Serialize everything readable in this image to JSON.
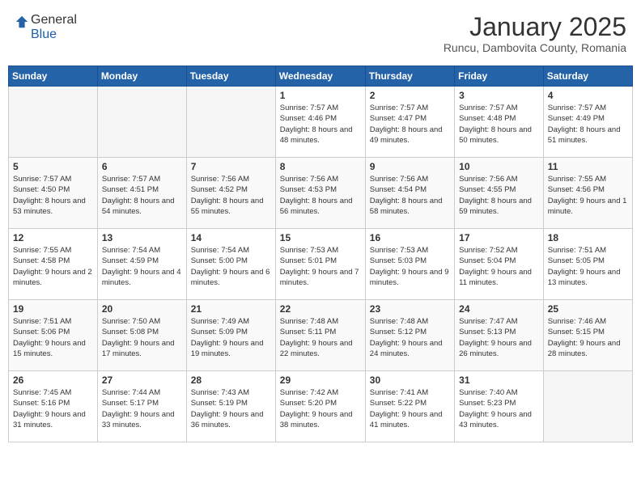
{
  "header": {
    "logo_line1": "General",
    "logo_line2": "Blue",
    "month_title": "January 2025",
    "location": "Runcu, Dambovita County, Romania"
  },
  "weekdays": [
    "Sunday",
    "Monday",
    "Tuesday",
    "Wednesday",
    "Thursday",
    "Friday",
    "Saturday"
  ],
  "weeks": [
    [
      {
        "day": "",
        "sunrise": "",
        "sunset": "",
        "daylight": "",
        "empty": true
      },
      {
        "day": "",
        "sunrise": "",
        "sunset": "",
        "daylight": "",
        "empty": true
      },
      {
        "day": "",
        "sunrise": "",
        "sunset": "",
        "daylight": "",
        "empty": true
      },
      {
        "day": "1",
        "sunrise": "7:57 AM",
        "sunset": "4:46 PM",
        "daylight": "8 hours and 48 minutes."
      },
      {
        "day": "2",
        "sunrise": "7:57 AM",
        "sunset": "4:47 PM",
        "daylight": "8 hours and 49 minutes."
      },
      {
        "day": "3",
        "sunrise": "7:57 AM",
        "sunset": "4:48 PM",
        "daylight": "8 hours and 50 minutes."
      },
      {
        "day": "4",
        "sunrise": "7:57 AM",
        "sunset": "4:49 PM",
        "daylight": "8 hours and 51 minutes."
      }
    ],
    [
      {
        "day": "5",
        "sunrise": "7:57 AM",
        "sunset": "4:50 PM",
        "daylight": "8 hours and 53 minutes."
      },
      {
        "day": "6",
        "sunrise": "7:57 AM",
        "sunset": "4:51 PM",
        "daylight": "8 hours and 54 minutes."
      },
      {
        "day": "7",
        "sunrise": "7:56 AM",
        "sunset": "4:52 PM",
        "daylight": "8 hours and 55 minutes."
      },
      {
        "day": "8",
        "sunrise": "7:56 AM",
        "sunset": "4:53 PM",
        "daylight": "8 hours and 56 minutes."
      },
      {
        "day": "9",
        "sunrise": "7:56 AM",
        "sunset": "4:54 PM",
        "daylight": "8 hours and 58 minutes."
      },
      {
        "day": "10",
        "sunrise": "7:56 AM",
        "sunset": "4:55 PM",
        "daylight": "8 hours and 59 minutes."
      },
      {
        "day": "11",
        "sunrise": "7:55 AM",
        "sunset": "4:56 PM",
        "daylight": "9 hours and 1 minute."
      }
    ],
    [
      {
        "day": "12",
        "sunrise": "7:55 AM",
        "sunset": "4:58 PM",
        "daylight": "9 hours and 2 minutes."
      },
      {
        "day": "13",
        "sunrise": "7:54 AM",
        "sunset": "4:59 PM",
        "daylight": "9 hours and 4 minutes."
      },
      {
        "day": "14",
        "sunrise": "7:54 AM",
        "sunset": "5:00 PM",
        "daylight": "9 hours and 6 minutes."
      },
      {
        "day": "15",
        "sunrise": "7:53 AM",
        "sunset": "5:01 PM",
        "daylight": "9 hours and 7 minutes."
      },
      {
        "day": "16",
        "sunrise": "7:53 AM",
        "sunset": "5:03 PM",
        "daylight": "9 hours and 9 minutes."
      },
      {
        "day": "17",
        "sunrise": "7:52 AM",
        "sunset": "5:04 PM",
        "daylight": "9 hours and 11 minutes."
      },
      {
        "day": "18",
        "sunrise": "7:51 AM",
        "sunset": "5:05 PM",
        "daylight": "9 hours and 13 minutes."
      }
    ],
    [
      {
        "day": "19",
        "sunrise": "7:51 AM",
        "sunset": "5:06 PM",
        "daylight": "9 hours and 15 minutes."
      },
      {
        "day": "20",
        "sunrise": "7:50 AM",
        "sunset": "5:08 PM",
        "daylight": "9 hours and 17 minutes."
      },
      {
        "day": "21",
        "sunrise": "7:49 AM",
        "sunset": "5:09 PM",
        "daylight": "9 hours and 19 minutes."
      },
      {
        "day": "22",
        "sunrise": "7:48 AM",
        "sunset": "5:11 PM",
        "daylight": "9 hours and 22 minutes."
      },
      {
        "day": "23",
        "sunrise": "7:48 AM",
        "sunset": "5:12 PM",
        "daylight": "9 hours and 24 minutes."
      },
      {
        "day": "24",
        "sunrise": "7:47 AM",
        "sunset": "5:13 PM",
        "daylight": "9 hours and 26 minutes."
      },
      {
        "day": "25",
        "sunrise": "7:46 AM",
        "sunset": "5:15 PM",
        "daylight": "9 hours and 28 minutes."
      }
    ],
    [
      {
        "day": "26",
        "sunrise": "7:45 AM",
        "sunset": "5:16 PM",
        "daylight": "9 hours and 31 minutes."
      },
      {
        "day": "27",
        "sunrise": "7:44 AM",
        "sunset": "5:17 PM",
        "daylight": "9 hours and 33 minutes."
      },
      {
        "day": "28",
        "sunrise": "7:43 AM",
        "sunset": "5:19 PM",
        "daylight": "9 hours and 36 minutes."
      },
      {
        "day": "29",
        "sunrise": "7:42 AM",
        "sunset": "5:20 PM",
        "daylight": "9 hours and 38 minutes."
      },
      {
        "day": "30",
        "sunrise": "7:41 AM",
        "sunset": "5:22 PM",
        "daylight": "9 hours and 41 minutes."
      },
      {
        "day": "31",
        "sunrise": "7:40 AM",
        "sunset": "5:23 PM",
        "daylight": "9 hours and 43 minutes."
      },
      {
        "day": "",
        "sunrise": "",
        "sunset": "",
        "daylight": "",
        "empty": true
      }
    ]
  ]
}
